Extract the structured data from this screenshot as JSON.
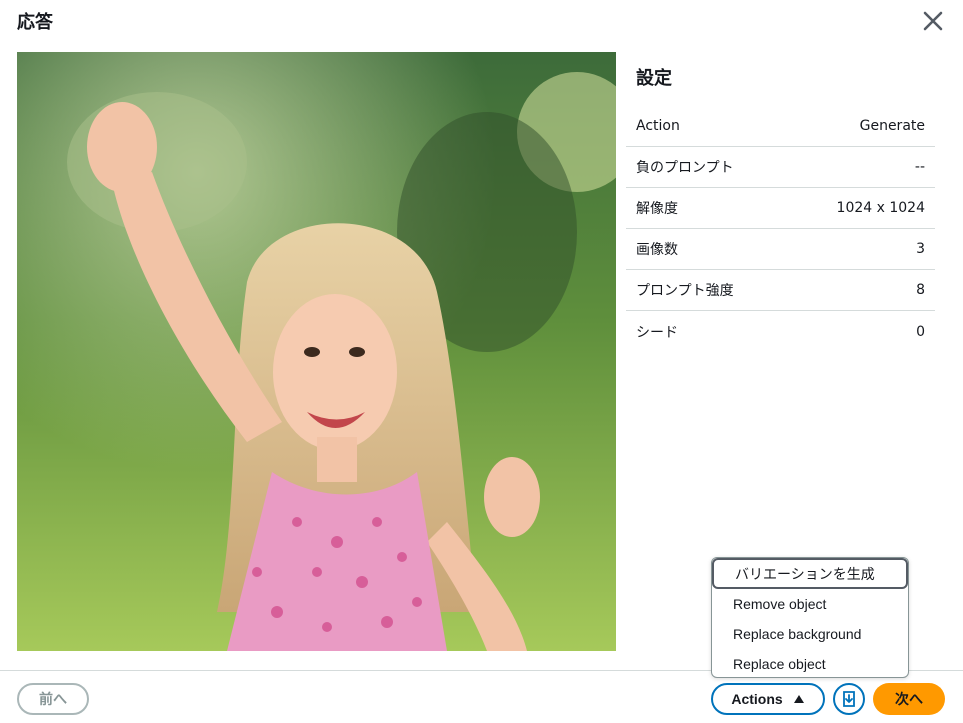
{
  "modal": {
    "title": "応答"
  },
  "settings": {
    "title": "設定",
    "rows": [
      {
        "key": "Action",
        "value": "Generate"
      },
      {
        "key": "負のプロンプト",
        "value": "--"
      },
      {
        "key": "解像度",
        "value": "1024 x 1024"
      },
      {
        "key": "画像数",
        "value": "3"
      },
      {
        "key": "プロンプト強度",
        "value": "8"
      },
      {
        "key": "シード",
        "value": "0"
      }
    ]
  },
  "footer": {
    "prev_label": "前へ",
    "actions_label": "Actions",
    "next_label": "次へ"
  },
  "actions_menu": {
    "items": [
      "バリエーションを生成",
      "Remove object",
      "Replace background",
      "Replace object"
    ]
  },
  "colors": {
    "accent": "#0073bb",
    "primary": "#ff9900",
    "border": "#d5dbdb",
    "disabled": "#aab7b8"
  },
  "icons": [
    "close-icon",
    "caret-up-icon",
    "download-icon"
  ]
}
